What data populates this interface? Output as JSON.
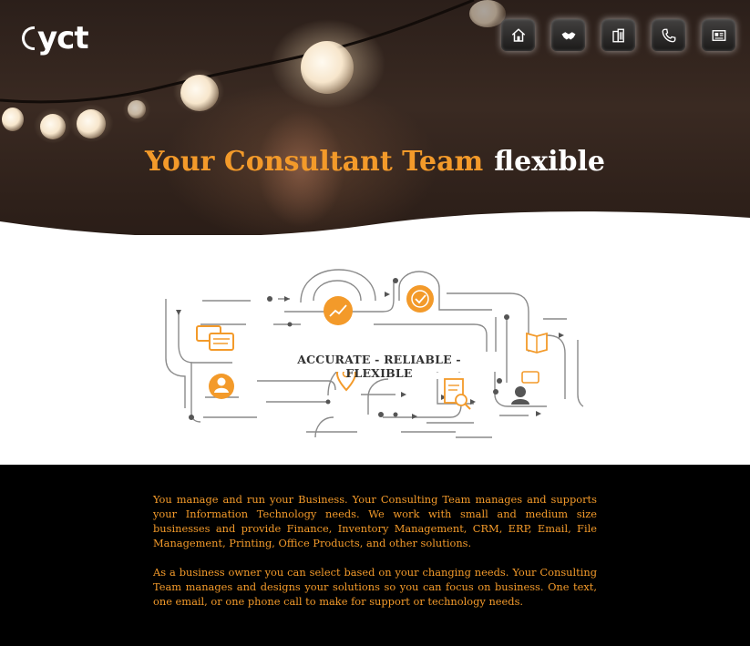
{
  "header": {
    "logo_text": "yct",
    "nav": [
      {
        "icon": "home-icon",
        "label": "Home"
      },
      {
        "icon": "handshake-icon",
        "label": "Partners"
      },
      {
        "icon": "building-icon",
        "label": "Company"
      },
      {
        "icon": "phone-icon",
        "label": "Contact"
      },
      {
        "icon": "newspaper-icon",
        "label": "News"
      }
    ]
  },
  "hero": {
    "tagline_main": "Your Consultant Team",
    "tagline_accent": "flexible"
  },
  "illustration": {
    "banner_text": "ACCURATE - RELIABLE - FLEXIBLE",
    "accent_color": "#f39a2a"
  },
  "content": {
    "paragraph_1": "You manage and run your Business. Your Consulting Team manages and supports your Information Technology needs. We work with small and medium size businesses and provide Finance, Inventory Management, CRM, ERP, Email, File Management, Printing, Office Products, and other solutions.",
    "paragraph_2": "As a business owner you can select based on your changing needs. Your Consulting Team manages and designs your solutions so you can focus on business. One text, one email, or one phone call to make for support or technology needs.",
    "text_color": "#f39a2a"
  }
}
